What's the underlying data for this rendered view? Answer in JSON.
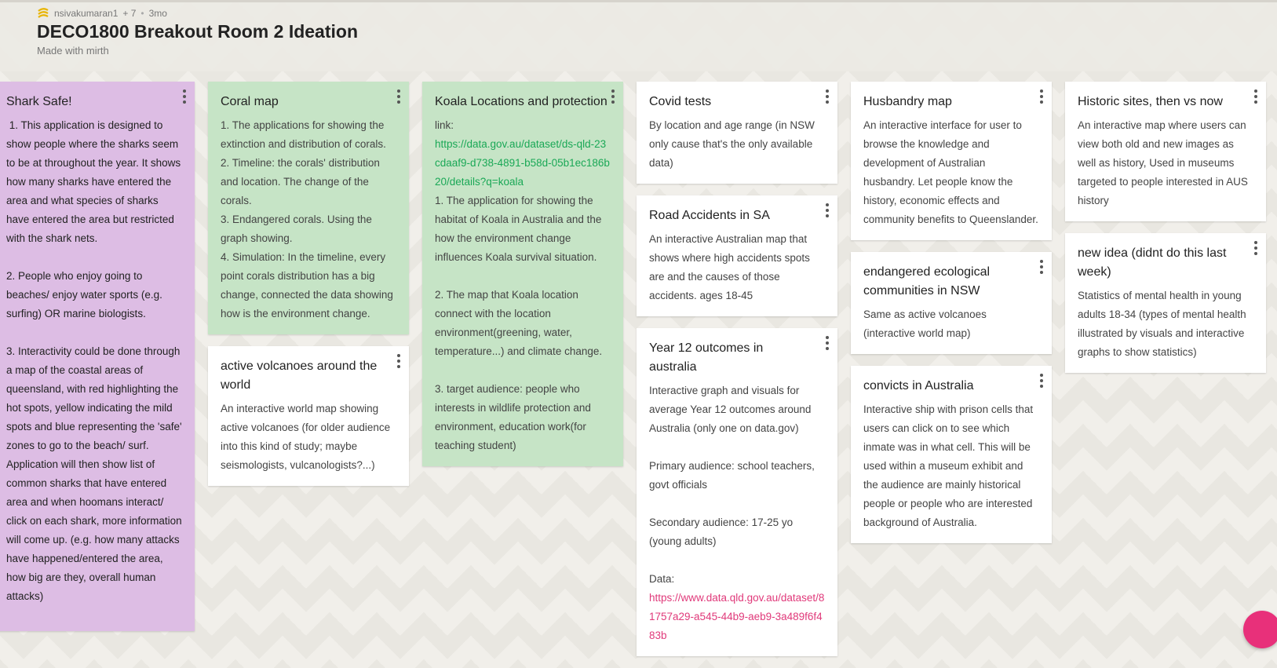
{
  "header": {
    "author": "nsivakumaran1",
    "contributors": "+ 7",
    "age": "3mo",
    "title": "DECO1800 Breakout Room 2 Ideation",
    "subtitle": "Made with mirth"
  },
  "colors": {
    "purple_card": "#ddbde4",
    "green_card": "#c6e4c6",
    "white_card": "#ffffff",
    "link_green": "#1aa856",
    "link_pink": "#e0397a",
    "fab": "#e8307a"
  },
  "cards": {
    "shark": {
      "title": "Shark Safe!",
      "body": " 1. This application is designed to show people where the sharks seem to be at throughout the year. It shows how many sharks have entered the area and what species of sharks have entered the area but restricted with the shark nets.\n\n2. People who enjoy going to beaches/ enjoy water sports (e.g. surfing) OR marine biologists.\n\n3. Interactivity could be done through a map of the coastal areas of queensland, with red highlighting the hot spots, yellow indicating the mild spots and blue representing the 'safe' zones to go to the beach/ surf. Application will then show list of common sharks that have entered area and when hoomans interact/ click on each shark, more information will come up. (e.g. how many attacks have happened/entered the area, how big are they, overall human attacks)"
    },
    "coral": {
      "title": "Coral map",
      "body": "1. The applications for showing the extinction and distribution of corals.\n2. Timeline: the corals' distribution and location. The change of the corals.\n3. Endangered corals. Using the graph showing.\n4. Simulation: In the timeline, every point corals distribution has a big change, connected the data showing how is the environment change."
    },
    "volcanoes": {
      "title": "active volcanoes around the world",
      "body": "An interactive world map showing active volcanoes (for older audience into this kind of study; maybe seismologists, vulcanologists?...)"
    },
    "koala": {
      "title": "Koala Locations and protection",
      "link_label": "link:",
      "link": "https://data.gov.au/dataset/ds-qld-23cdaaf9-d738-4891-b58d-05b1ec186b20/details?q=koala",
      "body": "1. The application for showing the habitat of Koala in Australia and the how the environment change influences Koala survival situation.\n\n2. The map that Koala location connect with the location environment(greening, water, temperature...) and climate change.\n\n3. target audience: people who interests in wildlife protection and environment, education work(for teaching student)"
    },
    "covid": {
      "title": "Covid tests",
      "body": "By location and age range (in NSW only cause that's the only available data)"
    },
    "road": {
      "title": "Road Accidents in SA",
      "body": "An interactive Australian map that shows where high accidents spots are and the causes of those accidents. ages 18-45"
    },
    "year12": {
      "title": "Year 12 outcomes in australia",
      "body": "Interactive graph and visuals for average Year 12 outcomes around Australia (only one on data.gov)\n\nPrimary audience: school teachers, govt officials\n\nSecondary audience: 17-25 yo (young adults)\n\nData:",
      "link": "https://www.data.qld.gov.au/dataset/81757a29-a545-44b9-aeb9-3a489f6f483b"
    },
    "husbandry": {
      "title": "Husbandry map",
      "body": "An interactive interface for user to browse the knowledge and development of Australian husbandry. Let people know the history, economic effects and community benefits to Queenslander."
    },
    "endangered": {
      "title": "endangered ecological communities in NSW",
      "body": "Same as active volcanoes (interactive world map)"
    },
    "convicts": {
      "title": "convicts in Australia",
      "body": "Interactive ship with prison cells that users can click on to see which inmate was in what cell. This will be used within a museum exhibit and the audience are mainly historical people or people who are interested background of Australia."
    },
    "historic": {
      "title": "Historic sites, then vs now",
      "body": "An interactive map where users can view both old and new images as well as history, Used in museums targeted to people interested in AUS history"
    },
    "newidea": {
      "title": "new idea (didnt do this last week)",
      "body": "Statistics of mental health in young adults 18-34 (types of mental health illustrated by visuals and interactive graphs to show statistics)"
    }
  }
}
